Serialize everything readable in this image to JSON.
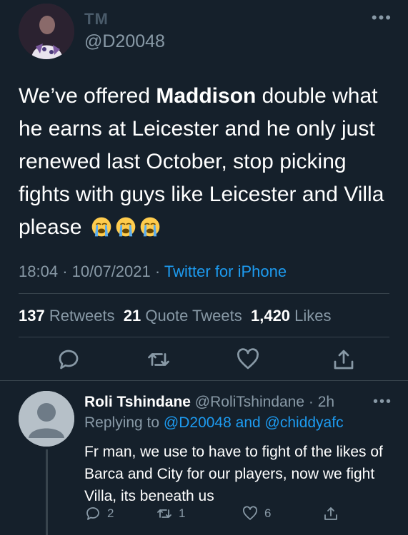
{
  "tweet": {
    "author_name": "TM",
    "author_handle": "@D20048",
    "text_before": "We’ve offered ",
    "text_bold": "Maddison",
    "text_after": " double what he earns at Leicester and he only just renewed last October, stop picking fights with guys like Leicester and Villa please",
    "emoji_icon": "loudly-crying-face-icon",
    "time": "18:04",
    "date": "10/07/2021",
    "separator": "·",
    "source": "Twitter for iPhone",
    "retweets_count": "137",
    "retweets_label": "Retweets",
    "quotes_count": "21",
    "quotes_label": "Quote Tweets",
    "likes_count": "1,420",
    "likes_label": "Likes"
  },
  "reply": {
    "author_name": "Roli Tshindane",
    "author_handle": "@RoliTshindane",
    "separator": "·",
    "time_ago": "2h",
    "replying_prefix": "Replying to",
    "replying_to_1": "@D20048",
    "replying_and": "and",
    "replying_to_2": "@chiddyafc",
    "text": "Fr man, we use to have to fight of the likes of Barca and City for our players, now we fight Villa, its beneath us",
    "reply_count": "2",
    "retweet_count": "1",
    "like_count": "6"
  },
  "colors": {
    "background": "#15202b",
    "accent": "#1d9bf0",
    "muted": "#8899a6",
    "divider": "#38444d"
  }
}
